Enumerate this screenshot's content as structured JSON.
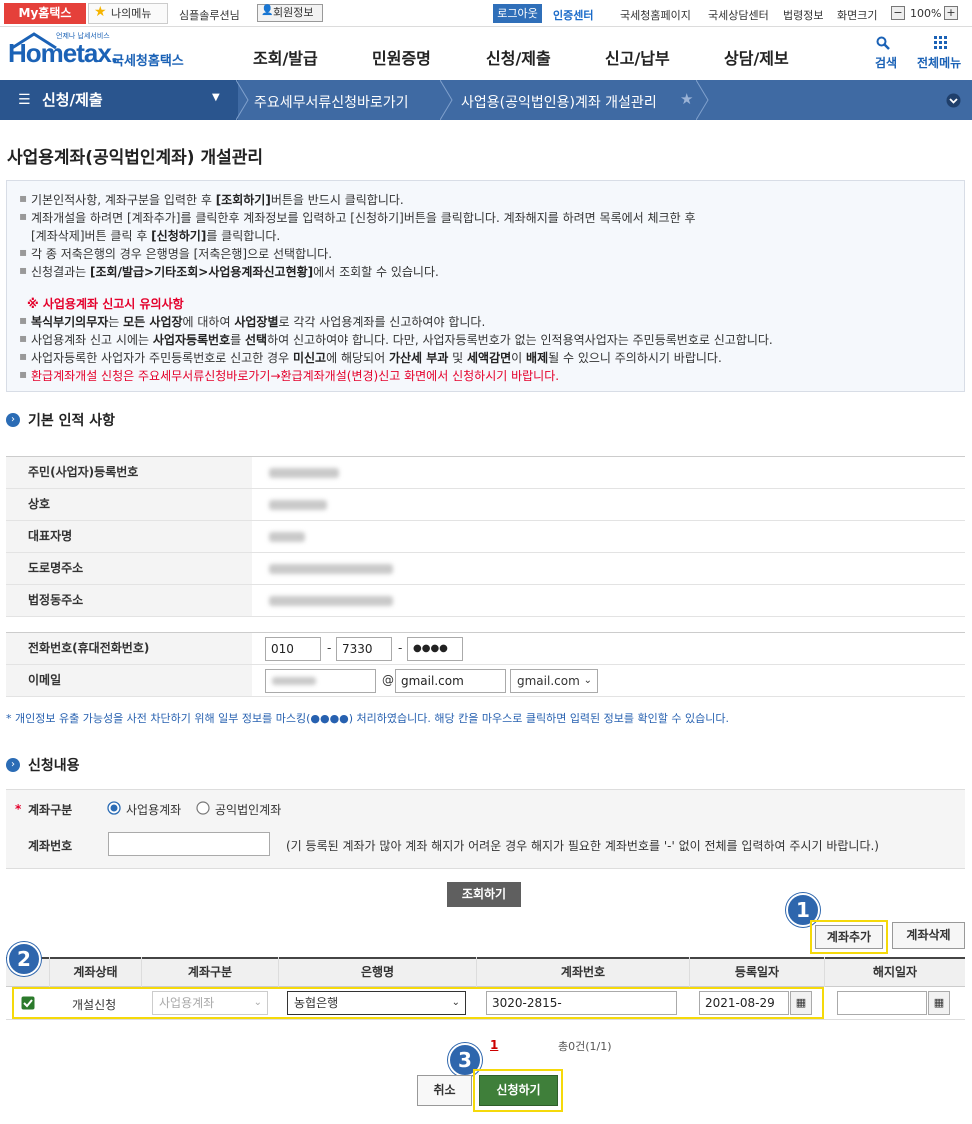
{
  "topbar": {
    "my_tax": "My홈택스",
    "my_menu": "나의메뉴",
    "user": "심플솔루션님",
    "member_info": "회원정보",
    "logout": "로그아웃",
    "cert_center": "인증센터",
    "links": [
      "국세청홈페이지",
      "국세상담센터",
      "법령정보",
      "화면크기"
    ],
    "zoom": "100%"
  },
  "header": {
    "logo": "Hometax.",
    "logo_sub": "국세청홈택스",
    "logo_tag": "언제나 납세서비스",
    "nav": [
      "조회/발급",
      "민원증명",
      "신청/제출",
      "신고/납부",
      "상담/제보"
    ],
    "search": "검색",
    "all_menu": "전체메뉴"
  },
  "breadcrumb": {
    "section": "신청/제출",
    "level2": "주요세무서류신청바로가기",
    "level3": "사업용(공익법인용)계좌 개설관리"
  },
  "page": {
    "title": "사업용계좌(공익법인계좌) 개설관리"
  },
  "info": {
    "l1a": "기본인적사항, 계좌구분을 입력한 후 ",
    "l1b": "[조회하기]",
    "l1c": "버튼을 반드시 클릭합니다.",
    "l2": "계좌개설을 하려면 [계좌추가]를 클릭한후 계좌정보를 입력하고 [신청하기]버튼을 클릭합니다. 계좌해지를 하려면 목록에서 체크한 후",
    "l3a": "[계좌삭제]버튼 클릭 후 ",
    "l3b": "[신청하기]",
    "l3c": "를 클릭합니다.",
    "l4": "각 종 저축은행의 경우 은행명을 [저축은행]으로 선택합니다.",
    "l5a": "신청결과는 ",
    "l5b": "[조회/발급>기타조회>사업용계좌신고현황]",
    "l5c": "에서 조회할 수 있습니다.",
    "warn_title": "※ 사업용계좌 신고시 유의사항",
    "w1a": "복식부기의무자",
    "w1b": "는 ",
    "w1c": "모든 사업장",
    "w1d": "에 대하여 ",
    "w1e": "사업장별",
    "w1f": "로 각각 사업용계좌를 신고하여야 합니다.",
    "w2a": "사업용계좌 신고 시에는 ",
    "w2b": "사업자등록번호",
    "w2c": "를 ",
    "w2d": "선택",
    "w2e": "하여 신고하여야 합니다. 다만, 사업자등록번호가 없는 인적용역사업자는 주민등록번호로 신고합니다.",
    "w3a": "사업자등록한 사업자가 주민등록번호로 신고한 경우 ",
    "w3b": "미신고",
    "w3c": "에 해당되어 ",
    "w3d": "가산세 부과",
    "w3e": " 및 ",
    "w3f": "세액감면",
    "w3g": "이 ",
    "w3h": "배제",
    "w3i": "될 수 있으니 주의하시기 바랍니다.",
    "w4": "환급계좌개설 신청은 주요세무서류신청바로가기→환급계좌개설(변경)신고 화면에서 신청하시기 바랍니다."
  },
  "basic": {
    "title": "기본 인적 사항",
    "labels": [
      "주민(사업자)등록번호",
      "상호",
      "대표자명",
      "도로명주소",
      "법정동주소"
    ],
    "phone_label": "전화번호(휴대전화번호)",
    "phone1": "010",
    "phone2": "7330",
    "phone3": "●●●●",
    "dash": "-",
    "email_label": "이메일",
    "at": "@",
    "email_domain": "gmail.com",
    "email_select": "gmail.com"
  },
  "notice": "* 개인정보 유출 가능성을 사전 차단하기 위해 일부 정보를 마스킹(●●●●) 처리하였습니다. 해당 칸을 마우스로 클릭하면 입력된 정보를 확인할 수 있습니다.",
  "apply": {
    "title": "신청내용",
    "req": "*",
    "type_label": "계좌구분",
    "opt1": "사업용계좌",
    "opt2": "공익법인계좌",
    "acct_label": "계좌번호",
    "acct_hint": "(기 등록된 계좌가 많아 계좌 해지가 어려운 경우 해지가 필요한 계좌번호를 '-' 없이 전체를 입력하여 주시기 바랍니다.)",
    "search_btn": "조회하기",
    "add_btn": "계좌추가",
    "del_btn": "계좌삭제"
  },
  "table": {
    "headers": [
      "계좌상태",
      "계좌구분",
      "은행명",
      "계좌번호",
      "등록일자",
      "해지일자"
    ],
    "row": {
      "status": "개설신청",
      "type": "사업용계좌",
      "bank": "농협은행",
      "account": "3020-2815-",
      "date": "2021-08-29",
      "close_date": ""
    }
  },
  "pagination": {
    "page": "1",
    "total": "총0건(1/1)"
  },
  "actions": {
    "cancel": "취소",
    "submit": "신청하기"
  },
  "badges": [
    "1",
    "2",
    "3"
  ],
  "colors": {
    "accent": "#2a558e",
    "highlight": "#f5d90a",
    "submit_green": "#3f7f3a",
    "warn_red": "#e4002b"
  }
}
